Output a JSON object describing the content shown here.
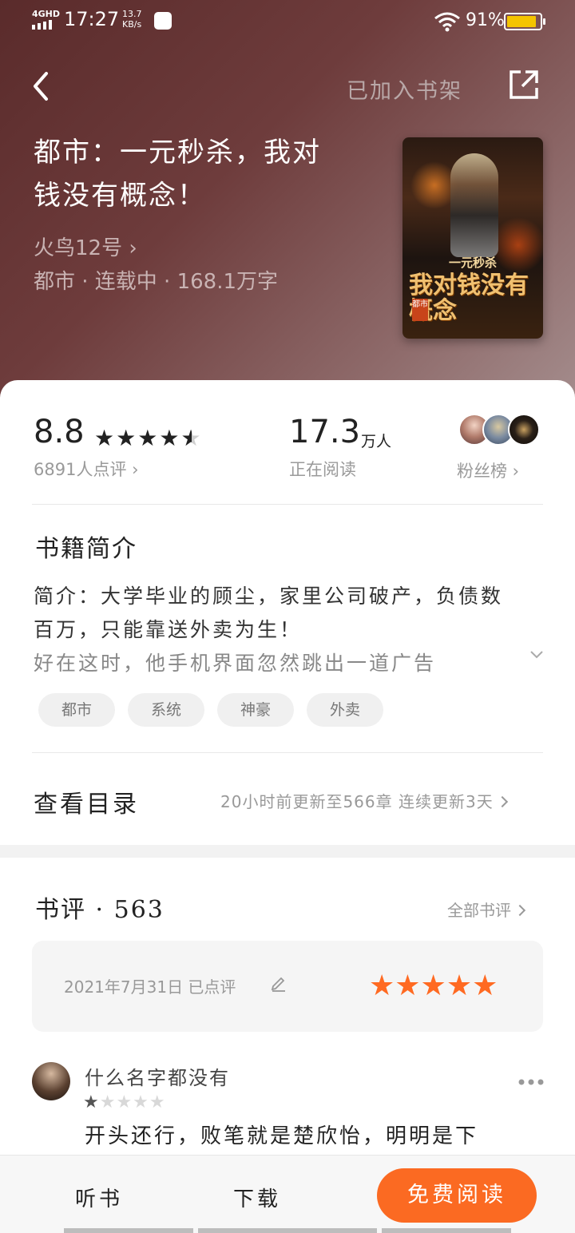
{
  "status_bar": {
    "network": "4GHD",
    "time": "17:27",
    "speed_value": "13.7",
    "speed_unit": "KB/s",
    "battery_pct": "91%",
    "battery_color": "#f5c400"
  },
  "header": {
    "shelf_label": "已加入书架",
    "back_icon": "chevron-left-icon",
    "share_icon": "share-icon"
  },
  "book": {
    "title": "都市：一元秒杀，我对钱没有概念！",
    "author": "火鸟12号 ›",
    "meta": "都市 · 连载中 · 168.1万字",
    "cover": {
      "subtitle": "一元秒杀",
      "main_title": "我对钱没有概念",
      "genre_badge": "都市"
    }
  },
  "stats": {
    "rating": "8.8",
    "rating_stars": 4.5,
    "reviews_count_label": "6891人点评 ›",
    "readers": "17.3",
    "readers_unit": "万人",
    "readers_label": "正在阅读",
    "fans_label": "粉丝榜 ›"
  },
  "intro": {
    "section_title": "书籍简介",
    "line1": "简介：大学毕业的顾尘，家里公司破产，负债数",
    "line2": "百万，只能靠送外卖为生！",
    "line3": "好在这时，他手机界面忽然跳出一道广告",
    "tags": [
      "都市",
      "系统",
      "神豪",
      "外卖"
    ]
  },
  "toc": {
    "title": "查看目录",
    "info": "20小时前更新至566章 连续更新3天"
  },
  "reviews": {
    "title": "书评 · 563",
    "all_label": "全部书评",
    "my_review": {
      "date": "2021年7月31日 已点评",
      "stars": 5,
      "star_color": "#ff6a22"
    },
    "items": [
      {
        "name": "什么名字都没有",
        "stars": 1,
        "text": "开头还行，败笔就是楚欣怡，明明是下"
      }
    ]
  },
  "bottom_bar": {
    "listen": "听书",
    "download": "下载",
    "read": "免费阅读",
    "accent": "#fb6a22"
  }
}
